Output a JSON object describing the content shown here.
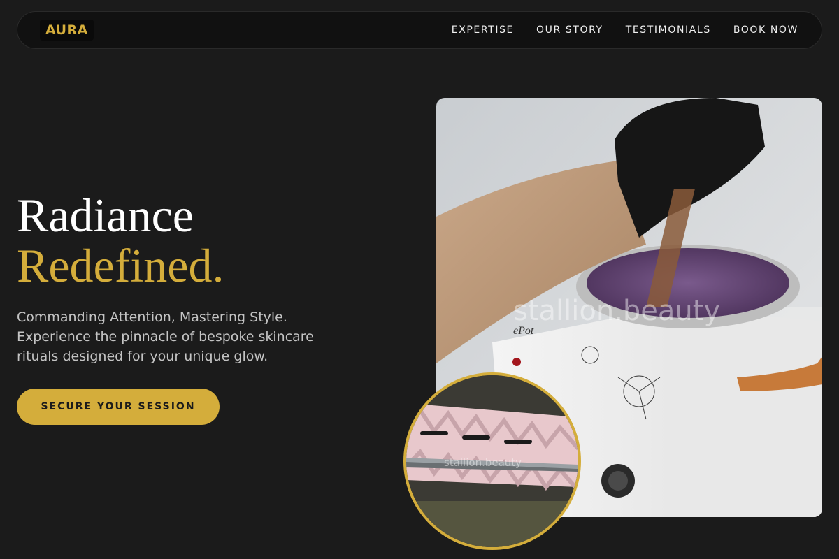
{
  "brand": {
    "logo": "AURA",
    "accent_color": "#d4ad3b"
  },
  "nav": {
    "items": [
      {
        "label": "EXPERTISE"
      },
      {
        "label": "OUR STORY"
      },
      {
        "label": "TESTIMONIALS"
      },
      {
        "label": "BOOK NOW"
      }
    ]
  },
  "hero": {
    "title_line1": "Radiance",
    "title_line2": "Redefined.",
    "subtitle": "Commanding Attention, Mastering Style. Experience the pinnacle of bespoke skincare rituals designed for your unique glow.",
    "cta_label": "SECURE YOUR SESSION"
  },
  "images": {
    "main": {
      "watermark": "stallion.beauty",
      "pot_label": "ePot"
    },
    "inset": {
      "watermark": "stallion.beauty"
    }
  }
}
